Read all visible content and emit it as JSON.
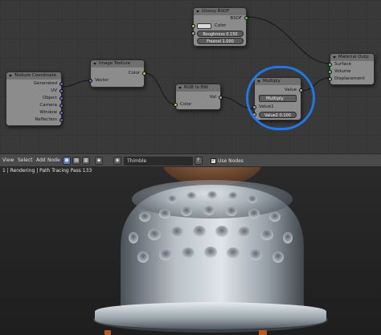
{
  "nodes": {
    "glossy_bsdf": {
      "title": "Glossy BSDF",
      "output": "BSDF",
      "color_label": "Color",
      "roughness_field": "Roughness 0.150",
      "fresnel_field": "Fresnel 1.000"
    },
    "texture_coordinate": {
      "title": "Texture Coordinate",
      "outputs": [
        "Generated",
        "UV",
        "Object",
        "Camera",
        "Window",
        "Reflection"
      ]
    },
    "image_texture": {
      "title": "Image Texture",
      "output": "Color",
      "input": "Vector"
    },
    "rgb_to_bw": {
      "title": "RGB to BW",
      "output": "Val",
      "input": "Color"
    },
    "multiply": {
      "title": "Multiply",
      "output": "Value",
      "operation": "Multiply",
      "input1": "Value1",
      "value2_field": "Value2 0.100"
    },
    "material_output": {
      "title": "Material Outp",
      "inputs": [
        "Surface",
        "Volume",
        "Displacement"
      ]
    }
  },
  "header": {
    "menus": [
      "View",
      "Select",
      "Add",
      "Node"
    ],
    "material_name": "Thimble",
    "use_nodes_label": "Use Nodes",
    "use_nodes_checked": "✓"
  },
  "render": {
    "status": "1 | Rendering | Path Tracing Pass 133"
  },
  "colors": {
    "highlight": "#1f78e6",
    "socket_yellow": "#c7c729",
    "socket_gray": "#a1a1a1",
    "socket_green": "#63c763",
    "socket_purple": "#6363c7"
  }
}
